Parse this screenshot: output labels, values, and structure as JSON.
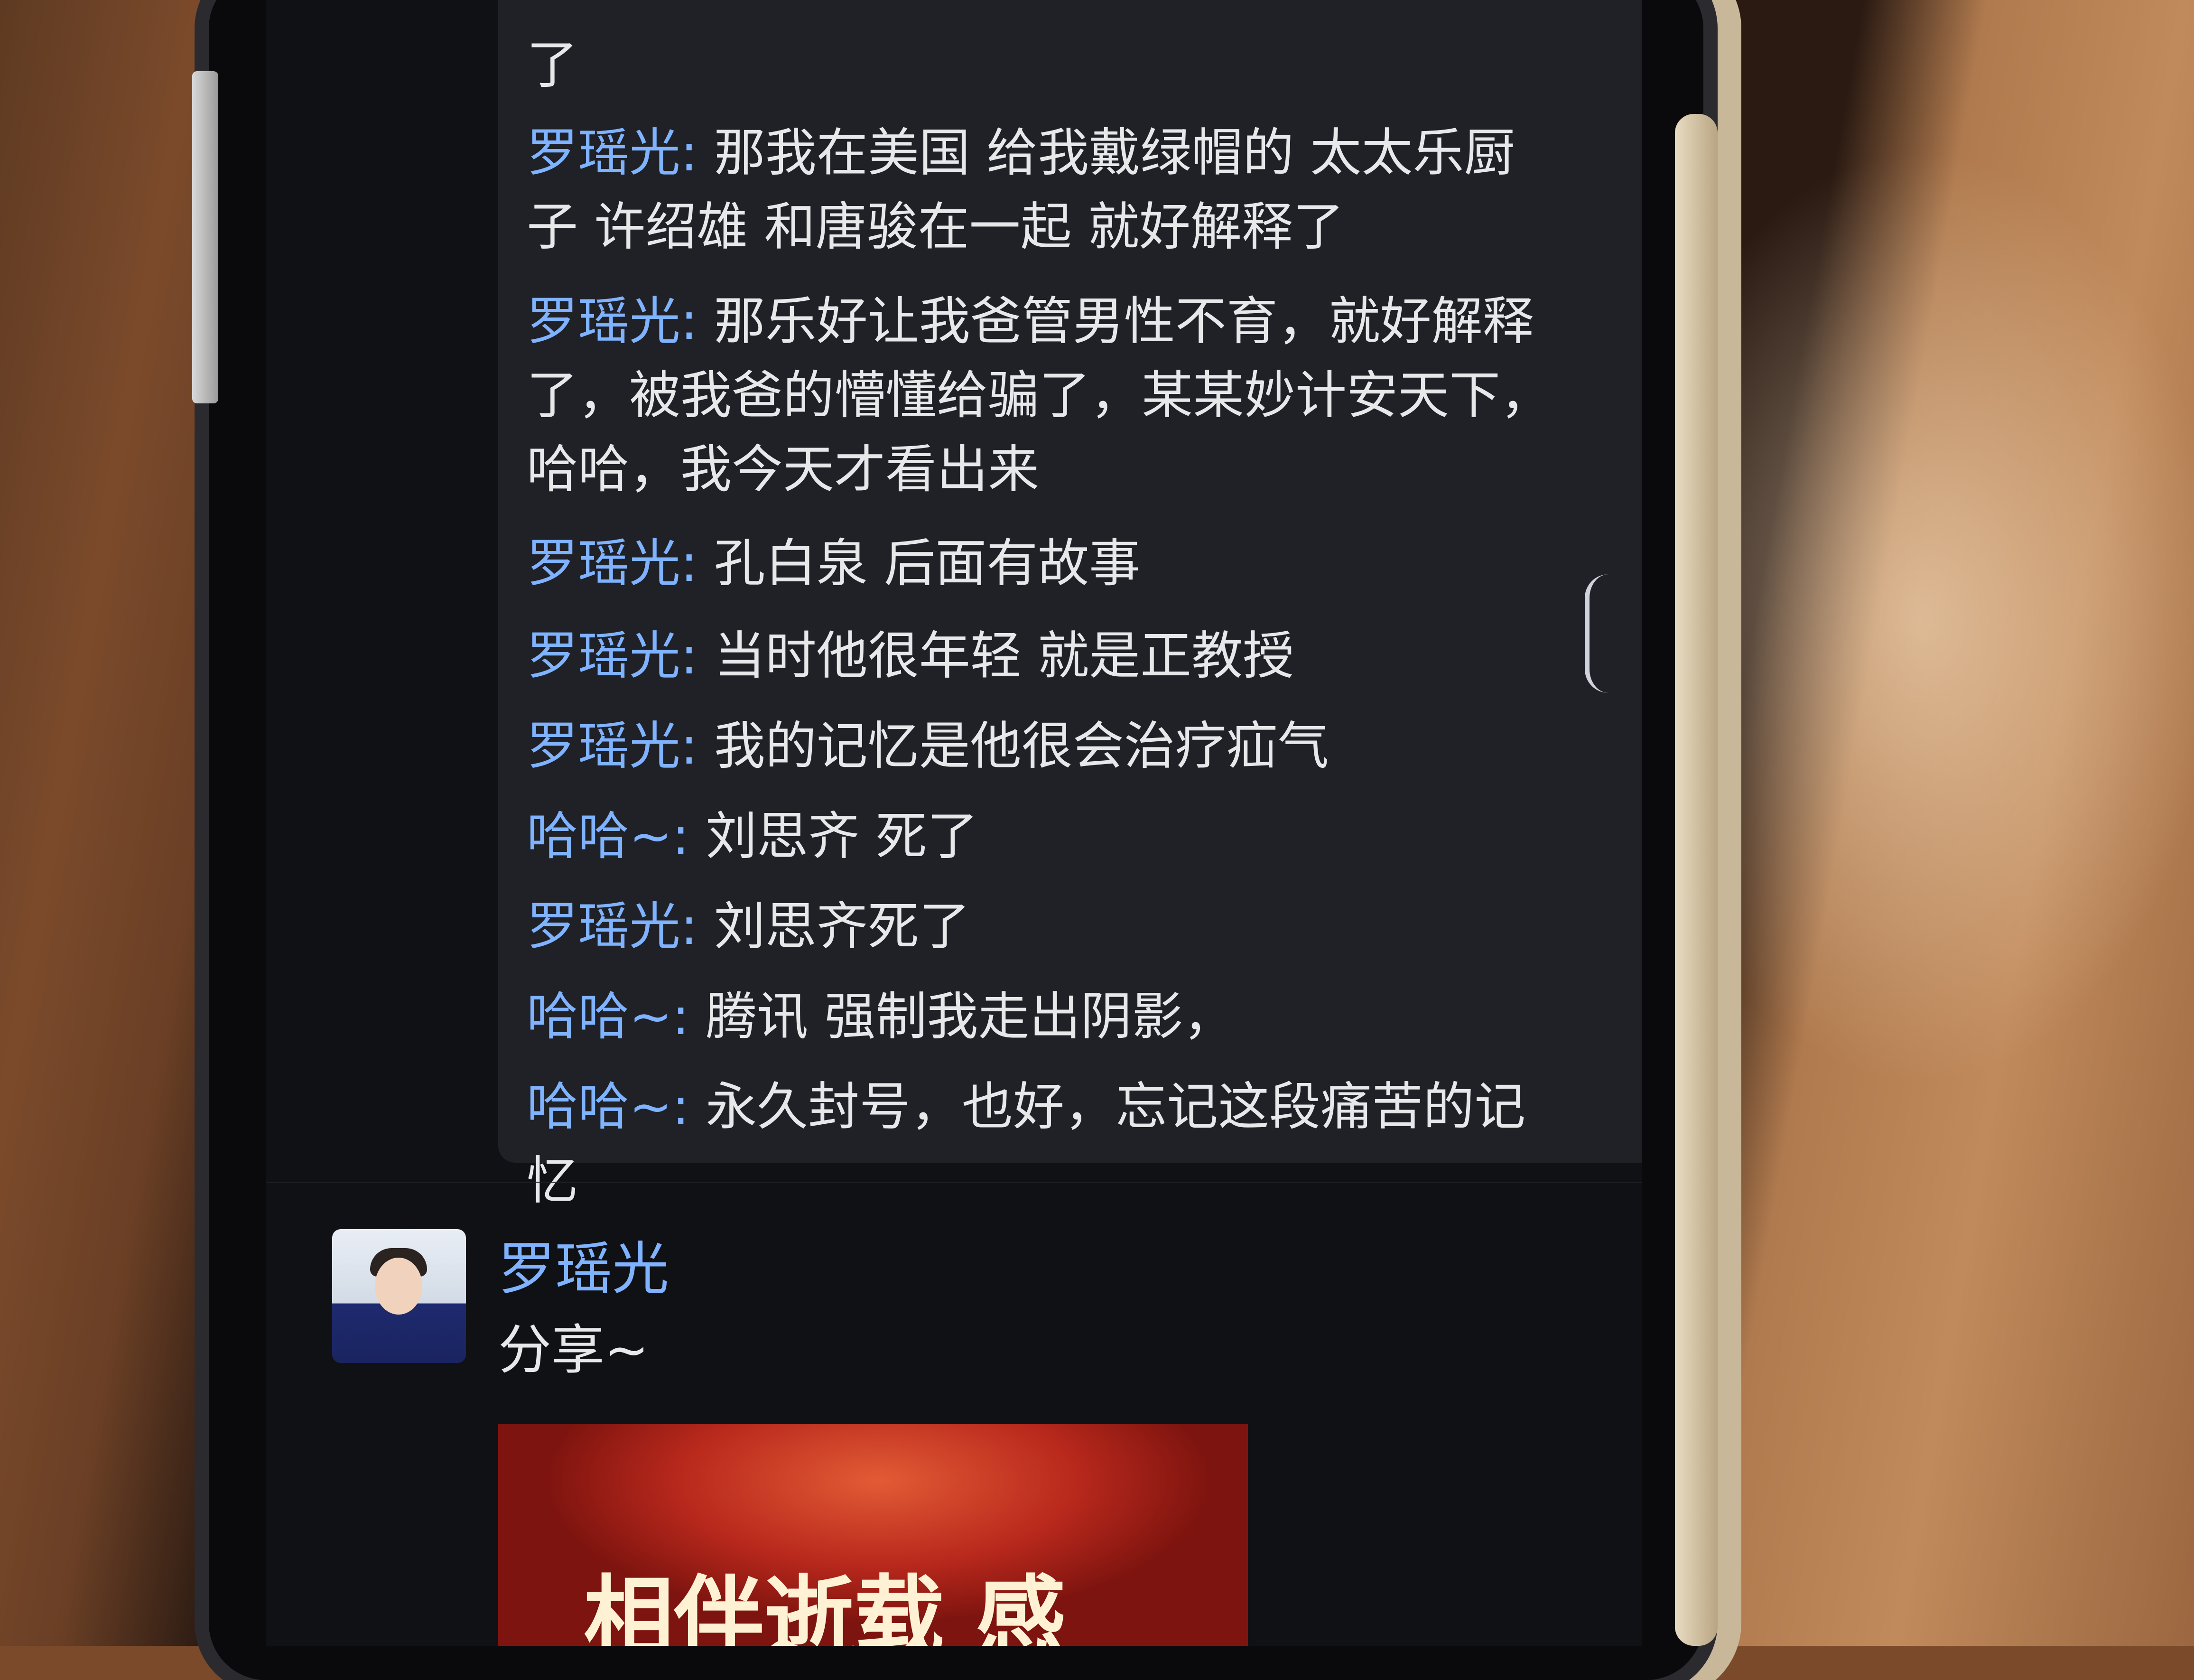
{
  "chat": {
    "partial_top_line": "了",
    "messages": [
      {
        "sender": "罗瑶光",
        "separator": ":",
        "text": " 那我在美国 给我戴绿帽的 太太乐厨子 许绍雄 和唐骏在一起 就好解释了"
      },
      {
        "sender": "罗瑶光",
        "separator": ":",
        "text": " 那乐好让我爸管男性不育，就好解释了，被我爸的懵懂给骗了，某某妙计安天下，哈哈，我今天才看出来"
      },
      {
        "sender": "罗瑶光",
        "separator": ":",
        "text": " 孔白泉 后面有故事"
      },
      {
        "sender": "罗瑶光",
        "separator": ":",
        "text": " 当时他很年轻 就是正教授"
      },
      {
        "sender": "罗瑶光",
        "separator": ":",
        "text": " 我的记忆是他很会治疗疝气"
      },
      {
        "sender": "哈哈~",
        "separator": ":",
        "text": " 刘思齐 死了"
      },
      {
        "sender": "罗瑶光",
        "separator": ":",
        "text": " 刘思齐死了"
      },
      {
        "sender": "哈哈~",
        "separator": ":",
        "text": " 腾讯 强制我走出阴影，"
      },
      {
        "sender": "哈哈~",
        "separator": ":",
        "text": " 永久封号，也好，忘记这段痛苦的记忆"
      }
    ]
  },
  "post": {
    "author": "罗瑶光",
    "text": "分享~",
    "image_caption": "相伴逝载 感"
  },
  "colors": {
    "sender": "#7fb2ff",
    "message_text": "#e7e8ea",
    "background": "#101114",
    "card": "#1f2126"
  }
}
